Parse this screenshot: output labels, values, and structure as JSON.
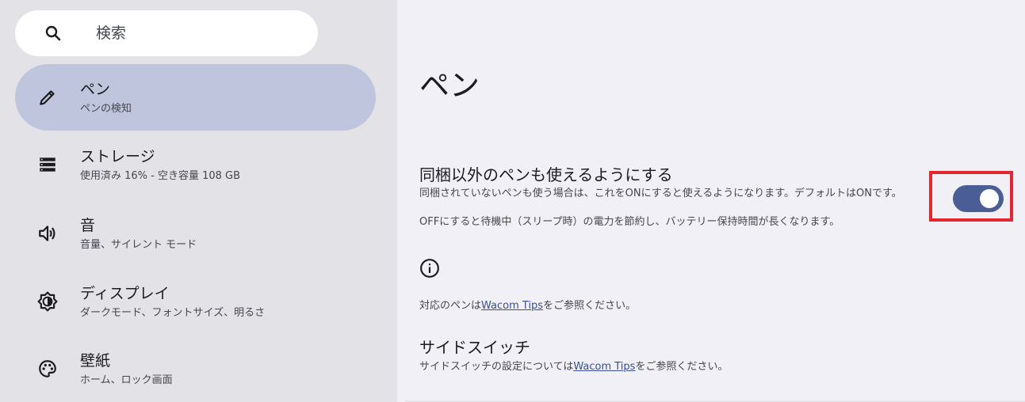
{
  "search": {
    "placeholder": "検索",
    "icon": "search-icon"
  },
  "sidebar": {
    "items": [
      {
        "title": "ペン",
        "subtitle": "ペンの検知",
        "icon": "pen-icon",
        "active": true
      },
      {
        "title": "ストレージ",
        "subtitle": "使用済み 16% - 空き容量 108 GB",
        "icon": "storage-icon",
        "active": false
      },
      {
        "title": "音",
        "subtitle": "音量、サイレント モード",
        "icon": "volume-icon",
        "active": false
      },
      {
        "title": "ディスプレイ",
        "subtitle": "ダークモード、フォントサイズ、明るさ",
        "icon": "brightness-icon",
        "active": false
      },
      {
        "title": "壁紙",
        "subtitle": "ホーム、ロック画面",
        "icon": "palette-icon",
        "active": false
      }
    ]
  },
  "main": {
    "title": "ペン",
    "setting": {
      "title": "同梱以外のペンも使えるようにする",
      "desc1": "同梱されていないペンも使う場合は、これをONにすると使えるようになります。デフォルトはONです。",
      "desc2": "OFFにすると待機中（スリープ時）の電力を節約し、バッテリー保持時間が長くなります。",
      "toggle_on": true
    },
    "info": {
      "icon": "info-icon",
      "prefix": "対応のペンは",
      "link": "Wacom Tips",
      "suffix": "をご参照ください。"
    },
    "side_switch": {
      "title": "サイドスイッチ",
      "prefix": "サイドスイッチの設定については",
      "link": "Wacom Tips",
      "suffix": "をご参照ください。"
    }
  },
  "colors": {
    "accent": "#4a5d94",
    "highlight_frame": "#e3262f",
    "active_item": "#bfc5dc",
    "sidebar_bg": "#e2e2e7",
    "main_bg": "#f1f0f6"
  }
}
